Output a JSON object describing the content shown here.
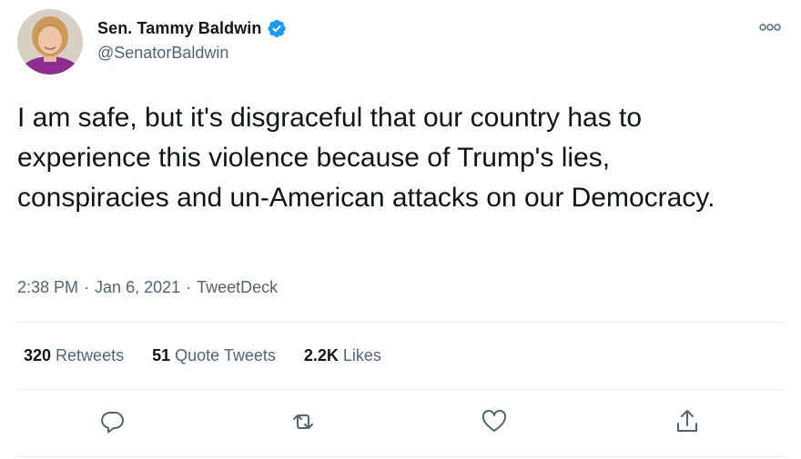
{
  "author": {
    "name": "Sen. Tammy Baldwin",
    "handle": "@SenatorBaldwin",
    "verified": true
  },
  "tweet": {
    "text": "I am safe, but it's disgraceful that our country has to experience this violence because of Trump's lies, conspiracies and un-American attacks on our Democracy.",
    "time": "2:38 PM",
    "date": "Jan 6, 2021",
    "source": "TweetDeck",
    "separator": "·"
  },
  "stats": {
    "retweets_count": "320",
    "retweets_label": "Retweets",
    "quotes_count": "51",
    "quotes_label": "Quote Tweets",
    "likes_count": "2.2K",
    "likes_label": "Likes"
  },
  "actions": [
    "reply-icon",
    "retweet-icon",
    "like-icon",
    "share-icon"
  ],
  "colors": {
    "text": "#0f1419",
    "secondary": "#536471",
    "verified": "#1d9bf0",
    "divider": "#e6ecf0"
  }
}
